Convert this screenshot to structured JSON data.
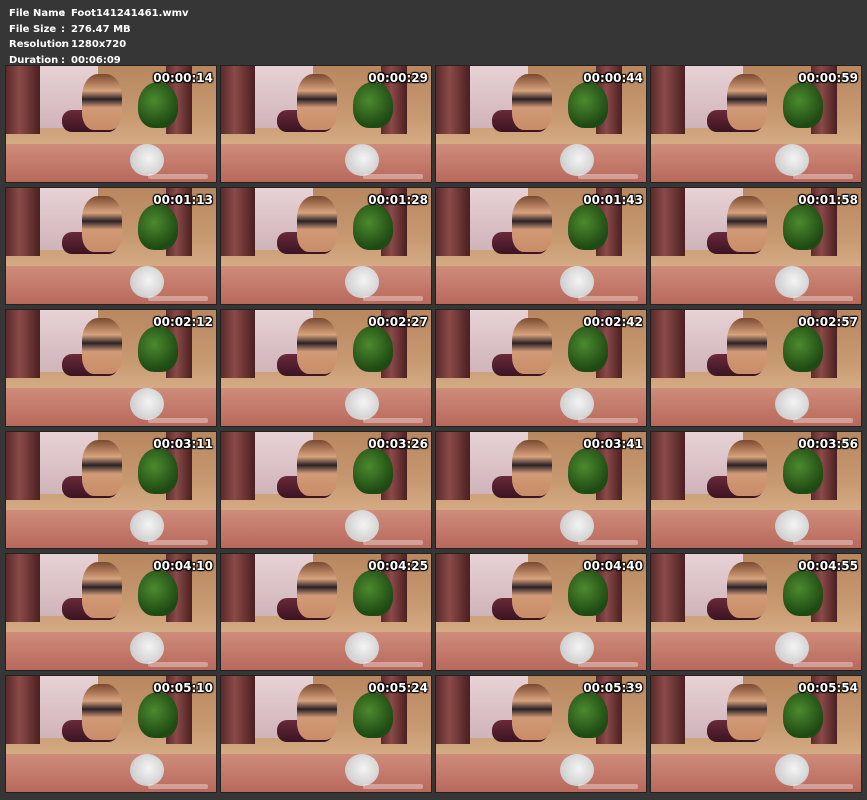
{
  "info": {
    "rows": [
      {
        "key": "File Name",
        "sep": ":",
        "value": "Foot141241461.wmv"
      },
      {
        "key": "File Size",
        "sep": ":",
        "value": "276.47 MB"
      },
      {
        "key": "Resolution",
        "sep": ":",
        "value": "1280x720"
      },
      {
        "key": "Duration",
        "sep": ":",
        "value": "00:06:09"
      }
    ]
  },
  "thumbnails": [
    {
      "timestamp": "00:00:14"
    },
    {
      "timestamp": "00:00:29"
    },
    {
      "timestamp": "00:00:44"
    },
    {
      "timestamp": "00:00:59"
    },
    {
      "timestamp": "00:01:13"
    },
    {
      "timestamp": "00:01:28"
    },
    {
      "timestamp": "00:01:43"
    },
    {
      "timestamp": "00:01:58"
    },
    {
      "timestamp": "00:02:12"
    },
    {
      "timestamp": "00:02:27"
    },
    {
      "timestamp": "00:02:42"
    },
    {
      "timestamp": "00:02:57"
    },
    {
      "timestamp": "00:03:11"
    },
    {
      "timestamp": "00:03:26"
    },
    {
      "timestamp": "00:03:41"
    },
    {
      "timestamp": "00:03:56"
    },
    {
      "timestamp": "00:04:10"
    },
    {
      "timestamp": "00:04:25"
    },
    {
      "timestamp": "00:04:40"
    },
    {
      "timestamp": "00:04:55"
    },
    {
      "timestamp": "00:05:10"
    },
    {
      "timestamp": "00:05:24"
    },
    {
      "timestamp": "00:05:39"
    },
    {
      "timestamp": "00:05:54"
    }
  ],
  "colors": {
    "background": "#363636",
    "text": "#ffffff"
  }
}
